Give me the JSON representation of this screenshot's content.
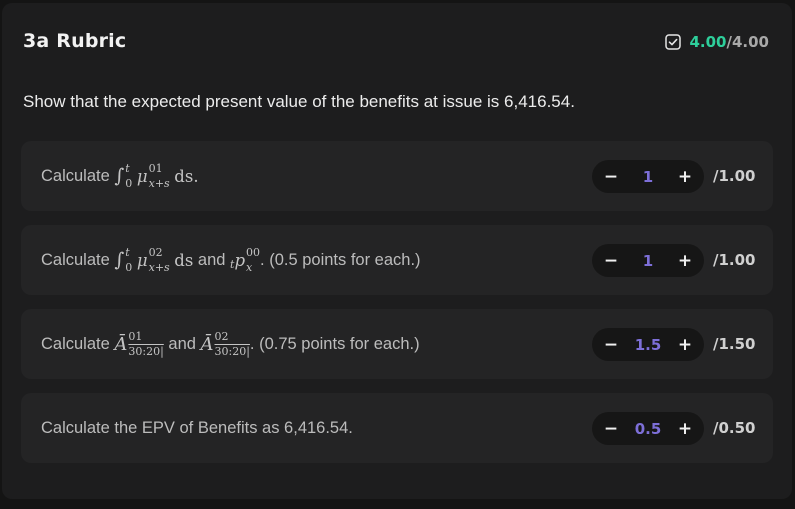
{
  "rubric": {
    "title": "3a Rubric",
    "score_got": "4.00",
    "score_sep": "/",
    "score_max": "4.00",
    "question": "Show that the expected present value of the benefits at issue is 6,416.54."
  },
  "items": [
    {
      "prefix": "Calculate",
      "math": {
        "integral_sign": "∫",
        "upper": "t",
        "lower": "0",
        "mu": "μ",
        "sup": "01",
        "sub": "x+s",
        "ds": "ds",
        "dot": "."
      },
      "value": "1",
      "max": "/1.00",
      "minus": "−",
      "plus": "+"
    },
    {
      "prefix": "Calculate",
      "math": {
        "integral_sign": "∫",
        "upper": "t",
        "lower": "0",
        "mu": "μ",
        "sup": "02",
        "sub": "x+s",
        "ds": "ds"
      },
      "mid": "and",
      "p": {
        "pre": "t",
        "p": "p",
        "sup": "00",
        "sub": "x"
      },
      "suffix": ". (0.5 points for each.)",
      "value": "1",
      "max": "/1.00",
      "minus": "−",
      "plus": "+"
    },
    {
      "prefix": "Calculate",
      "a1": {
        "A": "Ā",
        "sup": "01",
        "sub": "30:20|"
      },
      "mid": "and",
      "a2": {
        "A": "Ā",
        "sup": "02",
        "sub": "30:20|"
      },
      "suffix": ". (0.75 points for each.)",
      "value": "1.5",
      "max": "/1.50",
      "minus": "−",
      "plus": "+"
    },
    {
      "text": "Calculate the EPV of Benefits as 6,416.54.",
      "value": "0.5",
      "max": "/0.50",
      "minus": "−",
      "plus": "+"
    }
  ],
  "colors": {
    "background": "#141414",
    "card": "#1d1d1e",
    "item": "#242425",
    "score_accent": "#2ecf9b",
    "value_accent": "#7d6fd8"
  },
  "icons": {
    "score": "checkbox-checked-icon"
  }
}
